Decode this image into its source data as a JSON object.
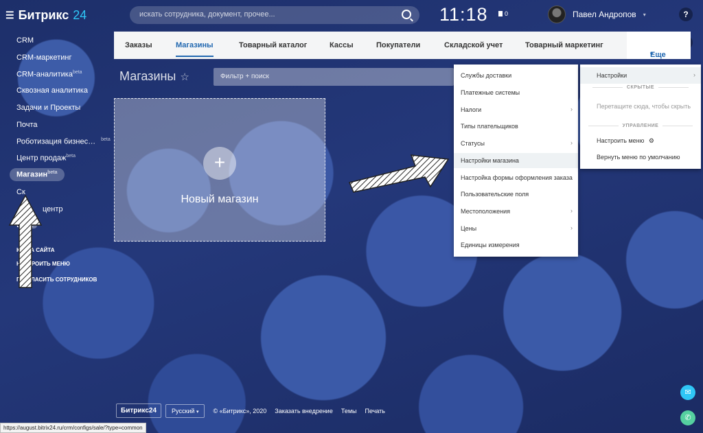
{
  "header": {
    "brand_name": "Битрикс",
    "brand_number": "24",
    "search_placeholder": "искать сотрудника, документ, прочее...",
    "clock": "11:18",
    "flag_count": "0",
    "user_name": "Павел Андропов",
    "help_glyph": "?"
  },
  "sidebar": {
    "items": [
      {
        "label": "CRM",
        "sup": ""
      },
      {
        "label": "CRM-маркетинг",
        "sup": ""
      },
      {
        "label": "CRM-аналитика",
        "sup": "beta"
      },
      {
        "label": "Сквозная аналитика",
        "sup": ""
      },
      {
        "label": "Задачи и Проекты",
        "sup": ""
      },
      {
        "label": "Почта",
        "sup": ""
      },
      {
        "label": "Роботизация бизнес…",
        "sup": "beta"
      },
      {
        "label": "Центр продаж",
        "sup": "beta"
      },
      {
        "label": "Магазин",
        "sup": "beta"
      }
    ],
    "partial_items": [
      {
        "label": "Ск"
      },
      {
        "label": "центр"
      },
      {
        "label": "Б",
        "counter": "1"
      }
    ],
    "small_items": [
      {
        "label": "КАРТА САЙТА"
      },
      {
        "label": "НАСТРОИТЬ МЕНЮ"
      },
      {
        "label": "ПРИГЛАСИТЬ СОТРУДНИКОВ"
      }
    ]
  },
  "tabs": {
    "items": [
      "Заказы",
      "Магазины",
      "Товарный каталог",
      "Кассы",
      "Покупатели",
      "Складской учет",
      "Товарный маркетинг"
    ],
    "active": "Магазины",
    "more_label": "Еще"
  },
  "page": {
    "title": "Магазины",
    "filter_placeholder": "Фильтр + поиск",
    "new_store_label": "Новый магазин"
  },
  "menu_settings": {
    "items": [
      {
        "label": "Службы доставки",
        "submenu": false
      },
      {
        "label": "Платежные системы",
        "submenu": false
      },
      {
        "label": "Налоги",
        "submenu": true
      },
      {
        "label": "Типы плательщиков",
        "submenu": false
      },
      {
        "label": "Статусы",
        "submenu": true
      },
      {
        "label": "Настройки магазина",
        "submenu": false,
        "highlighted": true
      },
      {
        "label": "Настройка формы оформления заказа",
        "submenu": false
      },
      {
        "label": "Пользовательские поля",
        "submenu": false
      },
      {
        "label": "Местоположения",
        "submenu": true
      },
      {
        "label": "Цены",
        "submenu": true
      },
      {
        "label": "Единицы измерения",
        "submenu": false
      }
    ]
  },
  "menu_more": {
    "settings_label": "Настройки",
    "hidden_section": "СКРЫТЫЕ",
    "drag_hint": "Перетащите сюда, чтобы скрыть",
    "manage_section": "УПРАВЛЕНИЕ",
    "configure_menu": "Настроить меню",
    "reset_menu": "Вернуть меню по умолчанию"
  },
  "footer": {
    "logo": "Битрикс24",
    "language": "Русский",
    "copyright": "© «Битрикс», 2020",
    "order_link": "Заказать внедрение",
    "themes_link": "Темы",
    "print_link": "Печать"
  },
  "status_url": "https://august.bitrix24.ru/crm/configs/sale/?type=common",
  "colors": {
    "brand_accent": "#2fc6f6",
    "active_tab": "#2067b0",
    "menu_highlight": "#eef2f4"
  },
  "icons": {
    "menu": "burger-icon",
    "search": "search-icon",
    "settings": "gear-icon",
    "favorite": "star-icon",
    "add": "plus-icon",
    "notifications": "bell-icon",
    "help": "question-icon",
    "chat": "chat-icon",
    "call": "phone-icon"
  }
}
